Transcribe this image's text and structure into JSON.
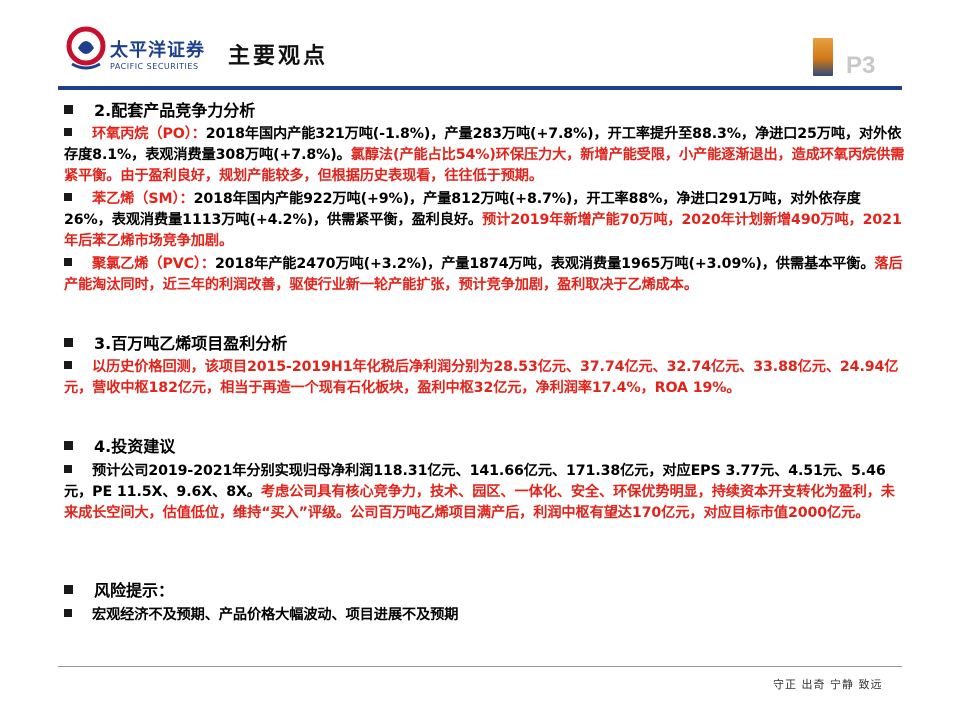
{
  "header": {
    "logo_cn": "太平洋证券",
    "logo_en": "PACIFIC SECURITIES",
    "title": "主要观点",
    "page_num": "P3"
  },
  "sections": [
    {
      "heading": "2.配套产品竞争力分析",
      "paragraphs": [
        {
          "label": "环氧丙烷（PO）：",
          "text": "2018年国内产能321万吨(-1.8%)，产量283万吨(+7.8%)，开工率提升至88.3%，净进口25万吨，对外依存度8.1%，表观消费量308万吨(+7.8%)。",
          "highlight": "氯醇法(产能占比54%)环保压力大，新增产能受限，小产能逐渐退出，造成环氧丙烷供需紧平衡。由于盈利良好，规划产能较多，但根据历史表现看，往往低于预期。"
        },
        {
          "label": "苯乙烯（SM）：",
          "text": "2018年国内产能922万吨(+9%)，产量812万吨(+8.7%)，开工率88%，净进口291万吨，对外依存度26%，表观消费量1113万吨(+4.2%)，供需紧平衡，盈利良好。",
          "highlight": "预计2019年新增产能70万吨，2020年计划新增490万吨，2021年后苯乙烯市场竞争加剧。"
        },
        {
          "label": "聚氯乙烯（PVC）：",
          "text": "2018年产能2470万吨(+3.2%)，产量1874万吨，表观消费量1965万吨(+3.09%)，供需基本平衡。",
          "highlight": "落后产能淘汰同时，近三年的利润改善，驱使行业新一轮产能扩张，预计竞争加剧，盈利取决于乙烯成本。"
        }
      ]
    },
    {
      "heading": "3.百万吨乙烯项目盈利分析",
      "paragraphs": [
        {
          "highlight": "以历史价格回测，该项目2015-2019H1年化税后净利润分别为28.53亿元、37.74亿元、32.74亿元、33.88亿元、24.94亿元，营收中枢182亿元，相当于再造一个现有石化板块，盈利中枢32亿元，净利润率17.4%，ROA 19%。"
        }
      ]
    },
    {
      "heading": "4.投资建议",
      "paragraphs": [
        {
          "text": "预计公司2019-2021年分别实现归母净利润118.31亿元、141.66亿元、171.38亿元，对应EPS 3.77元、4.51元、5.46元，PE 11.5X、9.6X、8X。",
          "highlight": "考虑公司具有核心竞争力，技术、园区、一体化、安全、环保优势明显，持续资本开支转化为盈利，未来成长空间大，估值低位，维持“买入”评级。公司百万吨乙烯项目满产后，利润中枢有望达170亿元，对应目标市值2000亿元。"
        }
      ]
    },
    {
      "heading": "风险提示：",
      "paragraphs": [
        {
          "text": "宏观经济不及预期、产品价格大幅波动、项目进展不及预期"
        }
      ]
    }
  ],
  "footer": {
    "motto": "守正 出奇 宁静 致远"
  },
  "colors": {
    "brand_blue": "#1e3f8e",
    "brand_red": "#c8102e",
    "highlight_red": "#e2231a"
  }
}
